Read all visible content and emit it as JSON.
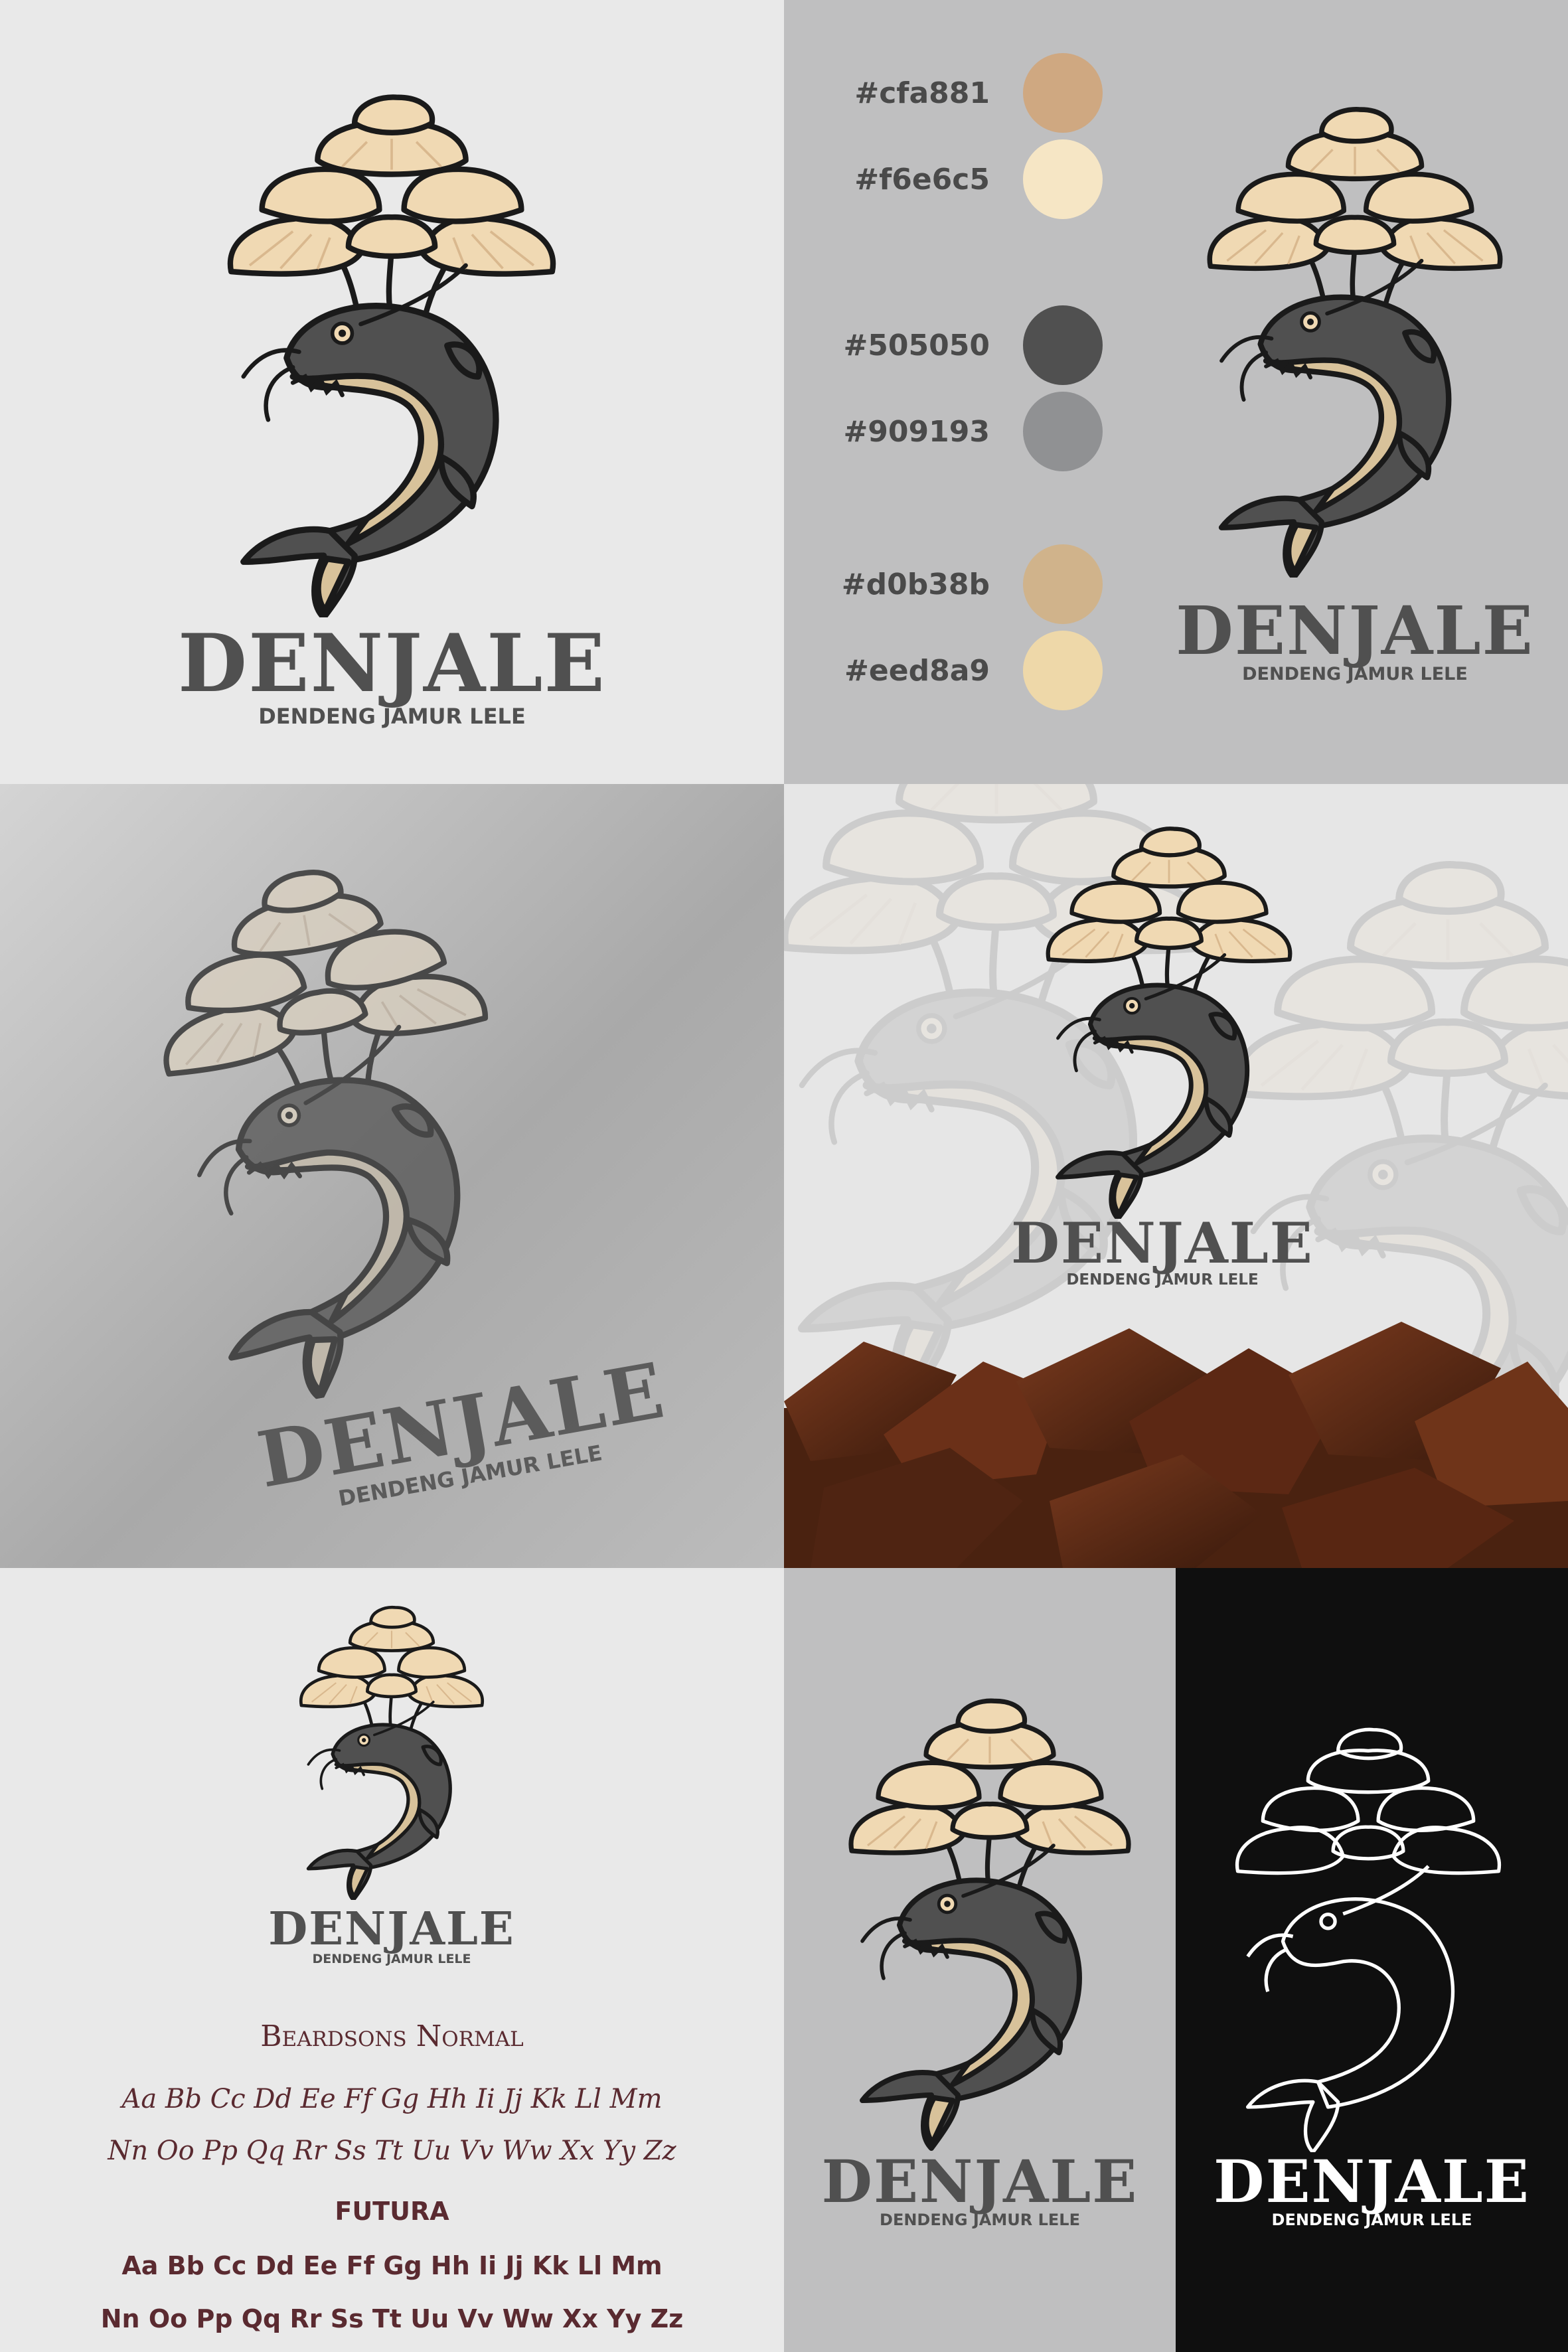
{
  "brand": {
    "name": "DENJALE",
    "tagline": "DENDENG JAMUR LELE"
  },
  "palette": [
    {
      "hex": "#cfa881"
    },
    {
      "hex": "#f6e6c5"
    },
    {
      "hex": "#505050"
    },
    {
      "hex": "#909193"
    },
    {
      "hex": "#d0b38b"
    },
    {
      "hex": "#eed8a9"
    }
  ],
  "typography": {
    "font_a_name": "Beardsons Normal",
    "font_a_line1": "Aa Bb Cc Dd Ee Ff Gg Hh Ii Jj Kk Ll Mm",
    "font_a_line2": "Nn Oo Pp Qq Rr Ss Tt Uu Vv Ww Xx Yy Zz",
    "font_b_name": "FUTURA",
    "font_b_line1": "Aa Bb Cc Dd Ee Ff Gg Hh Ii Jj Kk Ll Mm",
    "font_b_line2": "Nn Oo Pp Qq Rr Ss Tt Uu Vv Ww Xx Yy Zz"
  },
  "colors": {
    "panel_light": "#e9e9e9",
    "panel_grey": "#bfbfc0",
    "panel_black": "#0f0f0f",
    "mushroom_fill": "#f0d9b3",
    "mushroom_shade": "#d9b88e",
    "fish_dark": "#505050",
    "fish_belly": "#d8c29a",
    "outline": "#1a1a1a",
    "text_dark": "#505050",
    "font_sample": "#5a2a30"
  }
}
